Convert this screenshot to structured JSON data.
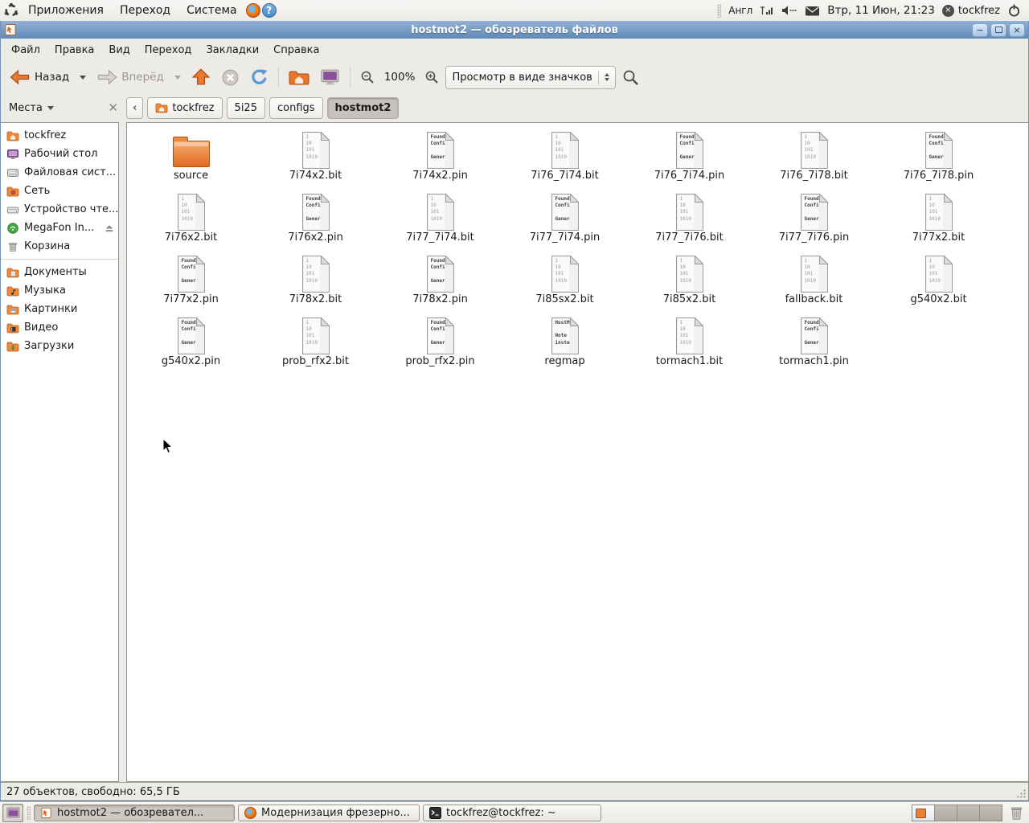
{
  "top_panel": {
    "menus": [
      {
        "label": "Приложения"
      },
      {
        "label": "Переход"
      },
      {
        "label": "Система"
      }
    ],
    "keyboard_layout": "Англ",
    "clock": "Втр, 11 Июн, 21:23",
    "user_name": "tockfrez"
  },
  "window": {
    "title": "hostmot2 — обозреватель файлов",
    "menu_bar": [
      {
        "label": "Файл"
      },
      {
        "label": "Правка"
      },
      {
        "label": "Вид"
      },
      {
        "label": "Переход"
      },
      {
        "label": "Закладки"
      },
      {
        "label": "Справка"
      }
    ],
    "toolbar": {
      "back_label": "Назад",
      "forward_label": "Вперёд",
      "zoom_level": "100%",
      "view_selector": "Просмотр в виде значков"
    },
    "places_header": "Места",
    "breadcrumbs": [
      {
        "label": "tockfrez"
      },
      {
        "label": "5i25"
      },
      {
        "label": "configs"
      },
      {
        "label": "hostmot2"
      }
    ],
    "sidebar_places": [
      {
        "key": "tockfrez",
        "label": "tockfrez",
        "icon": "home"
      },
      {
        "key": "desktop",
        "label": "Рабочий стол",
        "icon": "desktop"
      },
      {
        "key": "filesystem",
        "label": "Файловая сист...",
        "icon": "filesystem"
      },
      {
        "key": "network",
        "label": "Сеть",
        "icon": "network"
      },
      {
        "key": "optical-drive",
        "label": "Устройство чте...",
        "icon": "optical"
      },
      {
        "key": "megafon",
        "label": "MegaFon In...",
        "icon": "modem",
        "eject": true
      },
      {
        "key": "trash",
        "label": "Корзина",
        "icon": "trash"
      }
    ],
    "sidebar_folders": [
      {
        "key": "documents",
        "label": "Документы",
        "icon": "documents"
      },
      {
        "key": "music",
        "label": "Музыка",
        "icon": "music"
      },
      {
        "key": "pictures",
        "label": "Картинки",
        "icon": "pictures"
      },
      {
        "key": "videos",
        "label": "Видео",
        "icon": "videos"
      },
      {
        "key": "downloads",
        "label": "Загрузки",
        "icon": "downloads"
      }
    ],
    "files": [
      {
        "name": "source",
        "type": "folder"
      },
      {
        "name": "7i74x2.bit",
        "type": "bit"
      },
      {
        "name": "7i74x2.pin",
        "type": "pin"
      },
      {
        "name": "7i76_7i74.bit",
        "type": "bit"
      },
      {
        "name": "7i76_7i74.pin",
        "type": "pin"
      },
      {
        "name": "7i76_7i78.bit",
        "type": "bit"
      },
      {
        "name": "7i76_7i78.pin",
        "type": "pin"
      },
      {
        "name": "7i76x2.bit",
        "type": "bit"
      },
      {
        "name": "7i76x2.pin",
        "type": "pin"
      },
      {
        "name": "7i77_7i74.bit",
        "type": "bit"
      },
      {
        "name": "7i77_7i74.pin",
        "type": "pin"
      },
      {
        "name": "7i77_7i76.bit",
        "type": "bit"
      },
      {
        "name": "7i77_7i76.pin",
        "type": "pin"
      },
      {
        "name": "7i77x2.bit",
        "type": "bit"
      },
      {
        "name": "7i77x2.pin",
        "type": "pin"
      },
      {
        "name": "7i78x2.bit",
        "type": "bit"
      },
      {
        "name": "7i78x2.pin",
        "type": "pin"
      },
      {
        "name": "7i85sx2.bit",
        "type": "bit"
      },
      {
        "name": "7i85x2.bit",
        "type": "bit"
      },
      {
        "name": "fallback.bit",
        "type": "bit"
      },
      {
        "name": "g540x2.bit",
        "type": "bit"
      },
      {
        "name": "g540x2.pin",
        "type": "pin"
      },
      {
        "name": "prob_rfx2.bit",
        "type": "bit"
      },
      {
        "name": "prob_rfx2.pin",
        "type": "pin"
      },
      {
        "name": "regmap",
        "type": "regmap"
      },
      {
        "name": "tormach1.bit",
        "type": "bit"
      },
      {
        "name": "tormach1.pin",
        "type": "pin"
      }
    ],
    "file_previews": {
      "bit": "1\n10\n101\n1010",
      "pin": "Found\nConfi\n\nGener",
      "regmap": "HostM\n\nNote\ninste"
    },
    "status_bar": "27 объектов, свободно: 65,5 ГБ"
  },
  "taskbar": {
    "tasks": [
      {
        "label": "hostmot2 — обозревател...",
        "icon": "file-manager",
        "active": true
      },
      {
        "label": "Модернизация фрезерно...",
        "icon": "firefox",
        "active": false
      },
      {
        "label": "tockfrez@tockfrez: ~",
        "icon": "terminal",
        "active": false
      }
    ],
    "workspaces": {
      "count": 4,
      "active": 0
    }
  },
  "colors": {
    "titlebar_top": "#93b1d5",
    "titlebar_bottom": "#6089b6",
    "accent_orange": "#e9742c",
    "panel_bg": "#f1efec",
    "window_border": "#3a5876"
  }
}
